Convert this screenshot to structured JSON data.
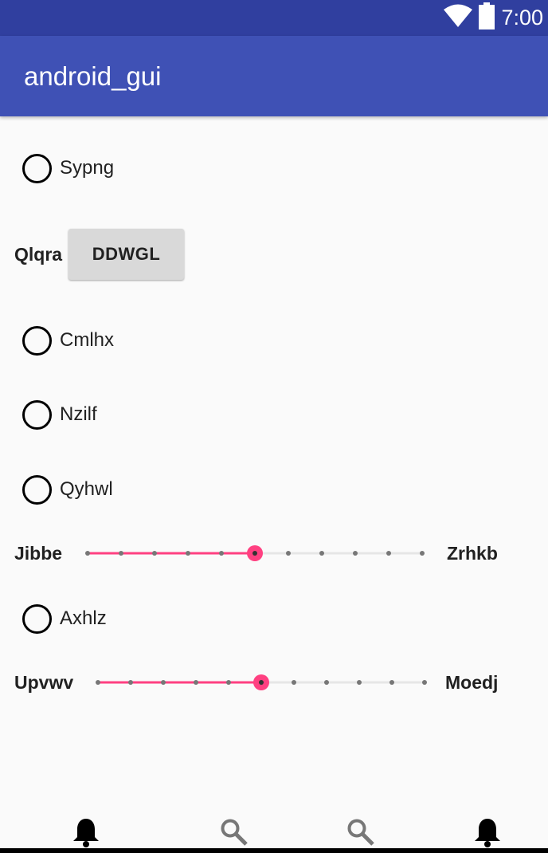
{
  "status_bar": {
    "time": "7:00",
    "icons": [
      "wifi-icon",
      "battery-icon"
    ]
  },
  "app_bar": {
    "title": "android_gui"
  },
  "radios": [
    {
      "label": "Sypng",
      "checked": false
    },
    {
      "label": "Cmlhx",
      "checked": false
    },
    {
      "label": "Nzilf",
      "checked": false
    },
    {
      "label": "Qyhwl",
      "checked": false
    },
    {
      "label": "Axhlz",
      "checked": false
    }
  ],
  "button_row": {
    "label": "Qlqra",
    "button": "DDWGL"
  },
  "seekbars": [
    {
      "left_label": "Jibbe",
      "right_label": "Zrhkb",
      "steps": 10,
      "value": 5
    },
    {
      "left_label": "Upvwv",
      "right_label": "Moedj",
      "steps": 10,
      "value": 5
    }
  ],
  "bottom_nav": {
    "items": [
      "bell-icon",
      "search-icon",
      "search-icon",
      "bell-icon"
    ]
  },
  "colors": {
    "primary": "#3f51b5",
    "primary_dark": "#303f9f",
    "accent": "#ff4081"
  }
}
